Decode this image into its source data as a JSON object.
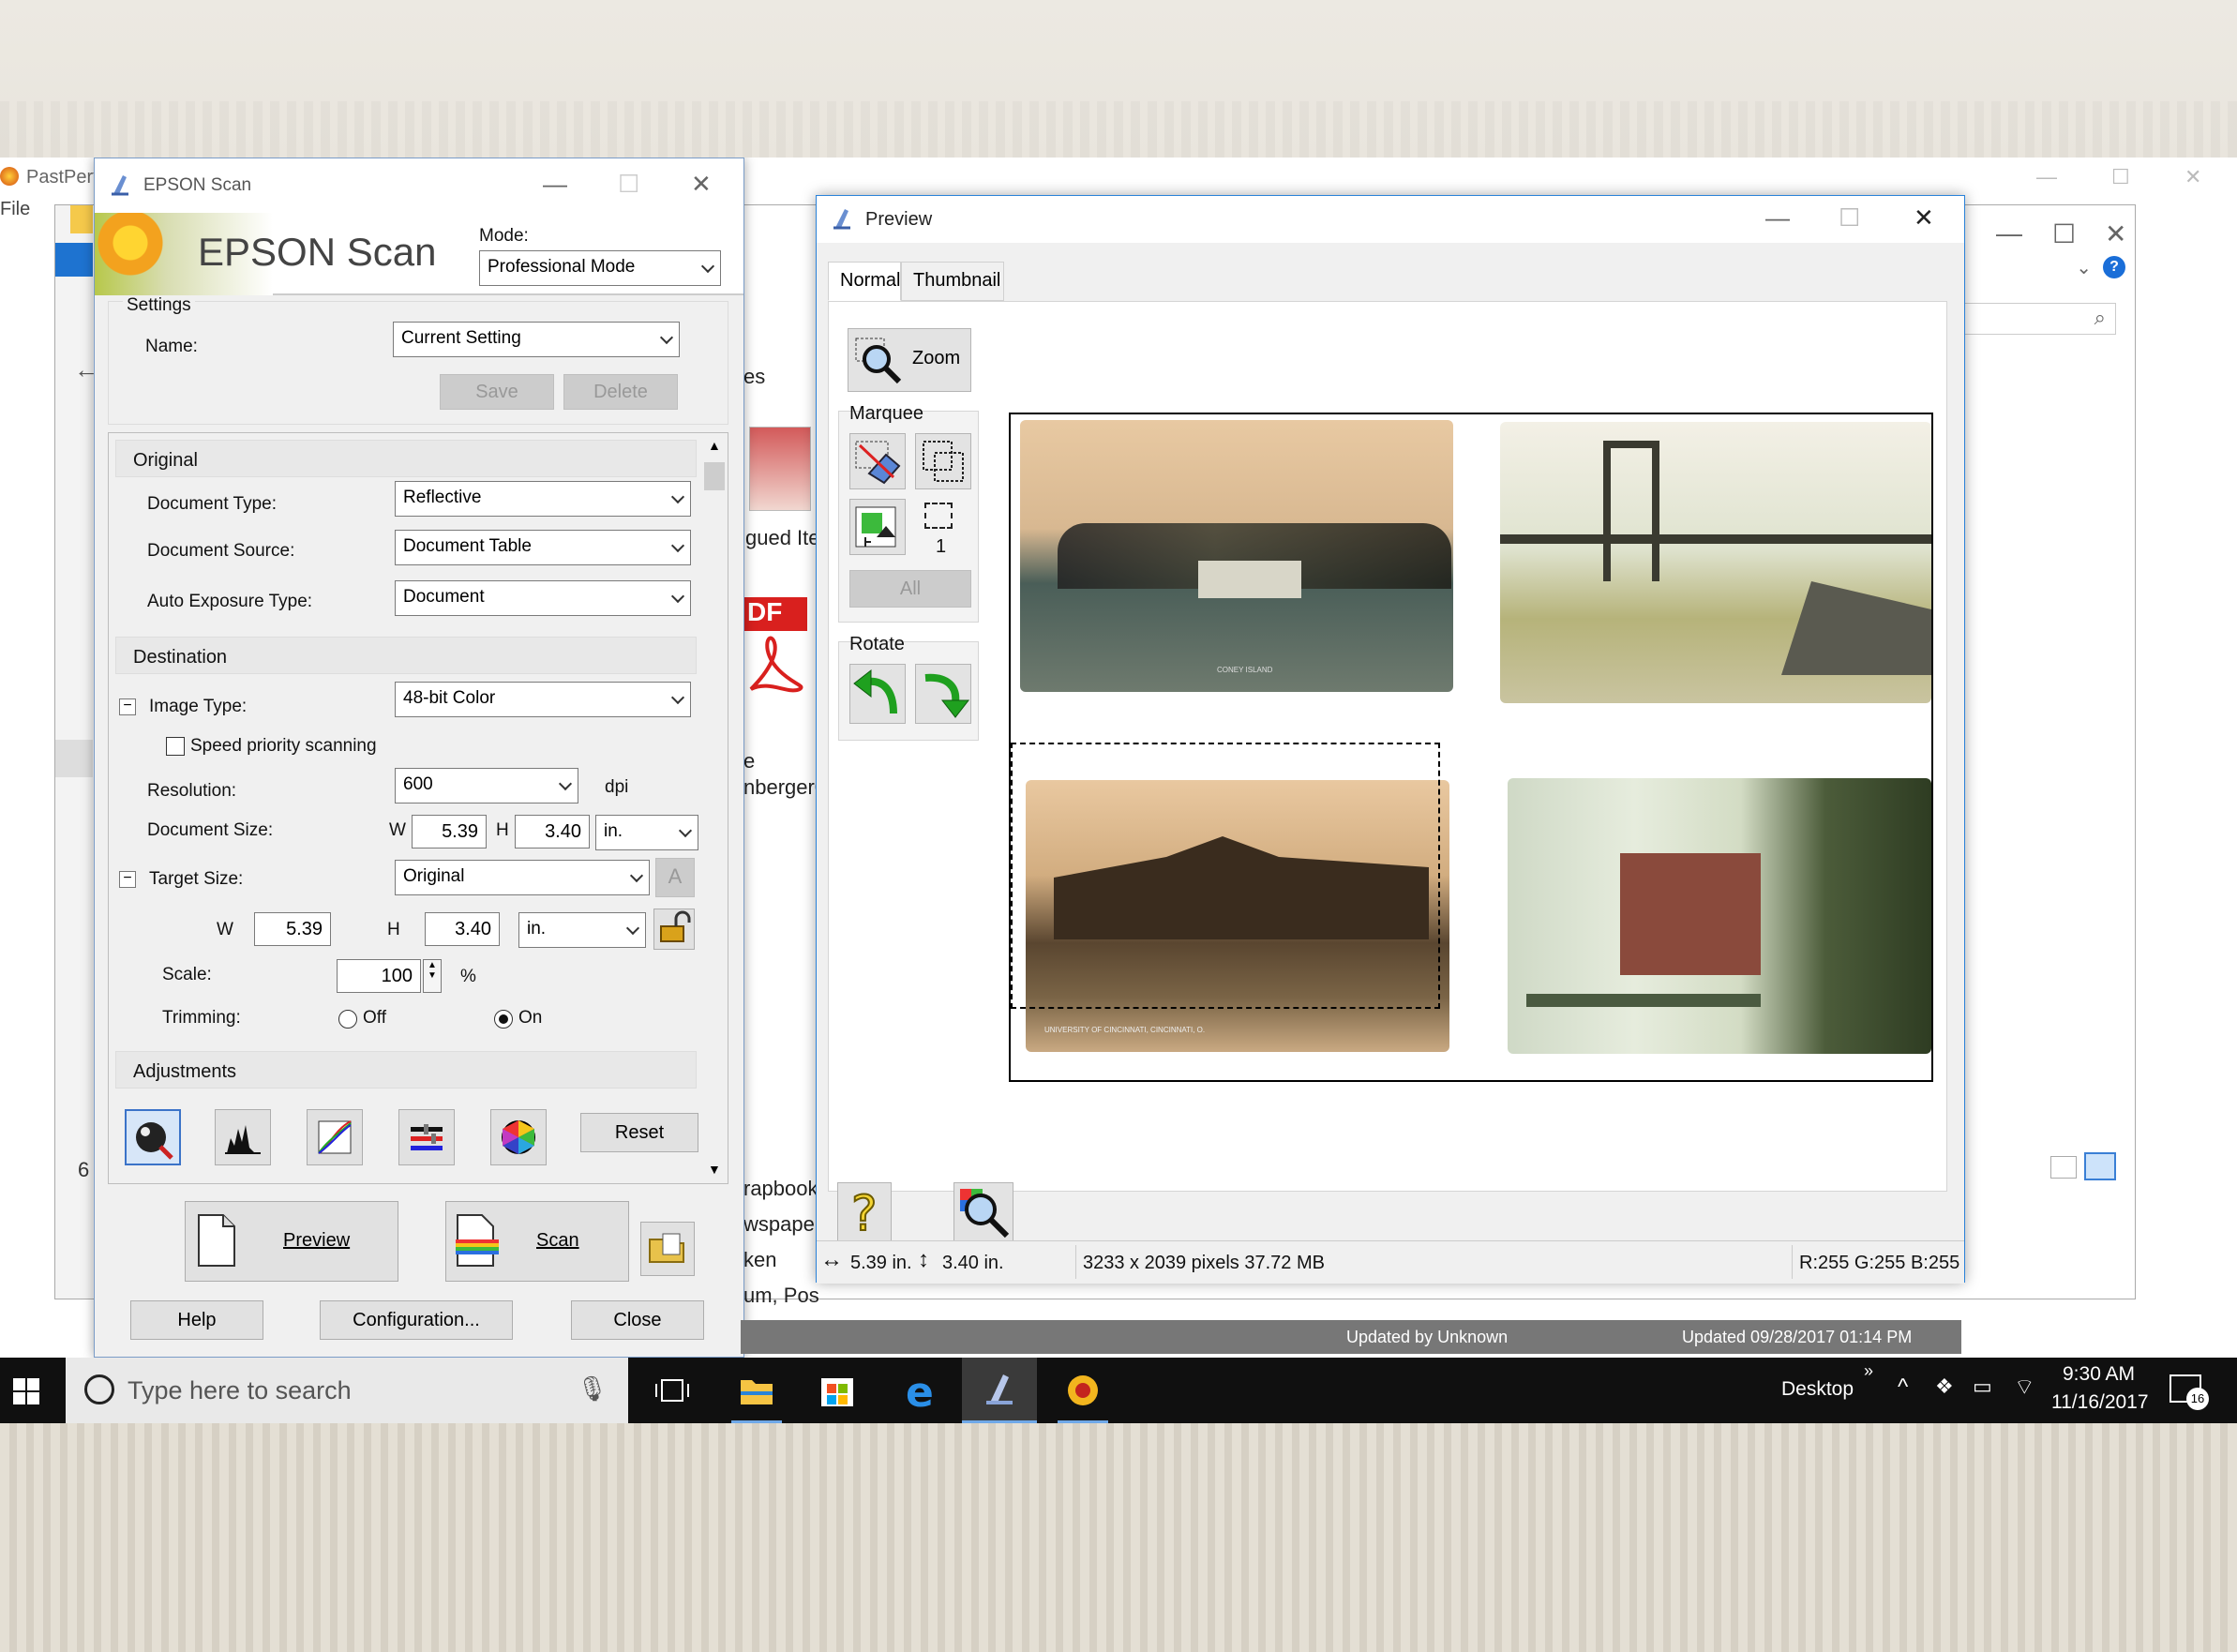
{
  "background_app": {
    "title": "PastPerf",
    "menu_file": "File",
    "explorer_texts": [
      "es",
      "gued Ite",
      "e",
      "nberger0",
      "rapbook",
      "wspape",
      "ken",
      "um, Pos",
      "um, Pos"
    ],
    "left_num": "6",
    "pdf_label": "DF"
  },
  "epson": {
    "title": "EPSON Scan",
    "logo": "EPSON Scan",
    "mode_label": "Mode:",
    "mode_value": "Professional Mode",
    "settings": {
      "group": "Settings",
      "name_label": "Name:",
      "name_value": "Current Setting",
      "save": "Save",
      "delete": "Delete"
    },
    "original": {
      "section": "Original",
      "doc_type_label": "Document Type:",
      "doc_type": "Reflective",
      "doc_source_label": "Document Source:",
      "doc_source": "Document Table",
      "auto_exp_label": "Auto Exposure Type:",
      "auto_exp": "Document"
    },
    "destination": {
      "section": "Destination",
      "image_type_label": "Image Type:",
      "image_type": "48-bit Color",
      "speed_label": "Speed priority scanning",
      "resolution_label": "Resolution:",
      "resolution": "600",
      "dpi": "dpi",
      "doc_size_label": "Document Size:",
      "w_label": "W",
      "doc_w": "5.39",
      "h_label": "H",
      "doc_h": "3.40",
      "unit": "in.",
      "target_label": "Target Size:",
      "target": "Original",
      "target_w_label": "W",
      "target_w": "5.39",
      "target_h_label": "H",
      "target_h": "3.40",
      "target_unit": "in.",
      "scale_label": "Scale:",
      "scale": "100",
      "percent": "%",
      "trimming_label": "Trimming:",
      "off": "Off",
      "on": "On"
    },
    "adjustments": {
      "section": "Adjustments",
      "reset": "Reset"
    },
    "buttons": {
      "preview": "Preview",
      "scan": "Scan",
      "help": "Help",
      "configuration": "Configuration...",
      "close": "Close"
    }
  },
  "preview": {
    "title": "Preview",
    "tabs": [
      "Normal",
      "Thumbnail"
    ],
    "zoom": "Zoom",
    "marquee_label": "Marquee",
    "marquee_count": "1",
    "all": "All",
    "rotate_label": "Rotate",
    "photo_captions": [
      "CONEY ISLAND",
      "UNIVERSITY OF CINCINNATI, CINCINNATI, O."
    ],
    "status": {
      "width": "5.39 in.",
      "height": "3.40 in.",
      "pixels": "3233 x 2039 pixels 37.72 MB",
      "rgb": "R:255 G:255 B:255"
    }
  },
  "updated_bar": {
    "updated_by": "Updated by  Unknown",
    "updated": "Updated    09/28/2017 01:14 PM"
  },
  "taskbar": {
    "search_placeholder": "Type here to search",
    "desktop": "Desktop",
    "time": "9:30 AM",
    "date": "11/16/2017",
    "notif_count": "16"
  },
  "colors": {
    "accent": "#1e73d0",
    "taskbar": "#101010",
    "rotate_green": "#1fa01f"
  }
}
